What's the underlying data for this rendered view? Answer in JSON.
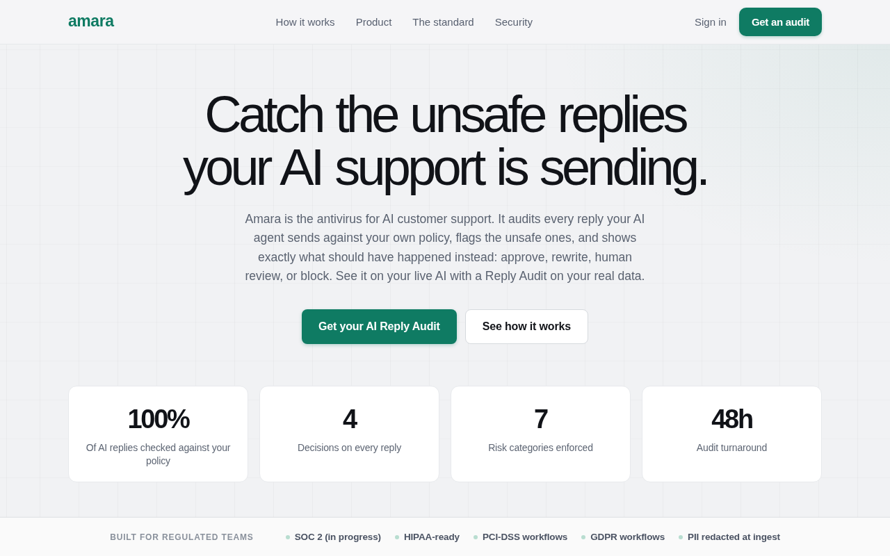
{
  "header": {
    "logo": "amara",
    "nav": [
      "How it works",
      "Product",
      "The standard",
      "Security"
    ],
    "sign_in": "Sign in",
    "cta": "Get an audit"
  },
  "hero": {
    "headline_lines": [
      "Catch the unsafe replies",
      "your AI support is sending."
    ],
    "description": "Amara is the antivirus for AI customer support. It audits every reply your AI agent sends against your own policy, flags the unsafe ones, and shows exactly what should have happened instead: approve, rewrite, human review, or block. See it on your live AI with a Reply Audit on your real data.",
    "buttons": [
      {
        "label": "Get your AI Reply Audit",
        "kind": "primary"
      },
      {
        "label": "See how it works",
        "kind": "secondary"
      }
    ]
  },
  "stats": [
    {
      "value": "100%",
      "label": "Of AI replies checked against your policy"
    },
    {
      "value": "4",
      "label": "Decisions on every reply"
    },
    {
      "value": "7",
      "label": "Risk categories enforced"
    },
    {
      "value": "48h",
      "label": "Audit turnaround"
    }
  ],
  "trust_bar": {
    "label": "BUILT FOR REGULATED TEAMS",
    "items": [
      "SOC 2 (in progress)",
      "HIPAA-ready",
      "PCI-DSS workflows",
      "GDPR workflows",
      "PII redacted at ingest"
    ]
  }
}
